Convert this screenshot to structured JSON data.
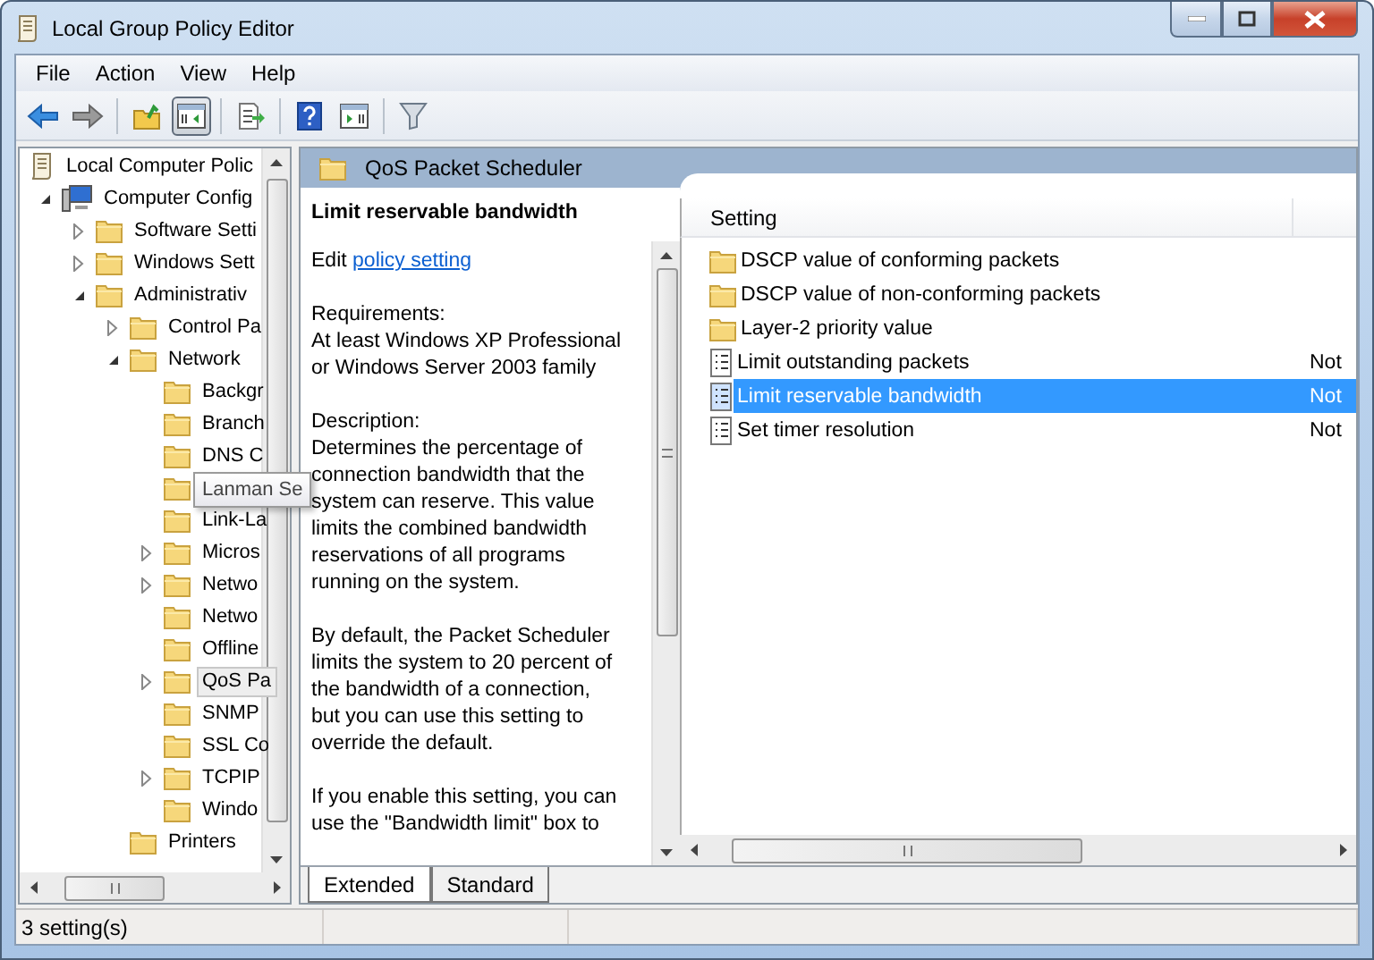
{
  "window": {
    "title": "Local Group Policy Editor"
  },
  "menu": [
    "File",
    "Action",
    "View",
    "Help"
  ],
  "toolbar": [
    {
      "kind": "back",
      "pressed": false
    },
    {
      "kind": "forward",
      "pressed": false
    },
    {
      "kind": "sep"
    },
    {
      "kind": "up",
      "pressed": false
    },
    {
      "kind": "tree",
      "pressed": true
    },
    {
      "kind": "sep"
    },
    {
      "kind": "export",
      "pressed": false
    },
    {
      "kind": "sep"
    },
    {
      "kind": "help",
      "pressed": false
    },
    {
      "kind": "pane",
      "pressed": false
    },
    {
      "kind": "sep"
    },
    {
      "kind": "filter",
      "pressed": false
    }
  ],
  "tree": [
    {
      "label": "Local Computer Polic",
      "kind": "policy",
      "selected": false,
      "children": [
        {
          "label": "Computer Config",
          "kind": "computer",
          "expanded": true,
          "selected": false,
          "children": [
            {
              "label": "Software Setti",
              "kind": "folder",
              "expanded": false,
              "selected": false
            },
            {
              "label": "Windows Sett",
              "kind": "folder",
              "expanded": false,
              "selected": false
            },
            {
              "label": "Administrativ",
              "kind": "folder",
              "expanded": true,
              "selected": false,
              "children": [
                {
                  "label": "Control Pa",
                  "kind": "folder",
                  "expanded": false,
                  "selected": false
                },
                {
                  "label": "Network",
                  "kind": "folder",
                  "expanded": true,
                  "selected": false,
                  "children": [
                    {
                      "label": "Backgr",
                      "kind": "folder",
                      "selected": false
                    },
                    {
                      "label": "Branch",
                      "kind": "folder",
                      "selected": false
                    },
                    {
                      "label": "DNS C",
                      "kind": "folder",
                      "selected": false
                    },
                    {
                      "tooltip": "Lanman Se",
                      "kind": "folder",
                      "selected": false
                    },
                    {
                      "label": "Link-La",
                      "kind": "folder",
                      "selected": false
                    },
                    {
                      "label": "Micros",
                      "kind": "folder",
                      "expanded": false,
                      "selected": false
                    },
                    {
                      "label": "Netwo",
                      "kind": "folder",
                      "expanded": false,
                      "selected": false
                    },
                    {
                      "label": "Netwo",
                      "kind": "folder",
                      "selected": false
                    },
                    {
                      "label": "Offline",
                      "kind": "folder",
                      "selected": false
                    },
                    {
                      "label": "QoS Pa",
                      "kind": "folder",
                      "expanded": false,
                      "selected": true
                    },
                    {
                      "label": "SNMP",
                      "kind": "folder",
                      "selected": false
                    },
                    {
                      "label": "SSL Co",
                      "kind": "folder",
                      "selected": false
                    },
                    {
                      "label": "TCPIP",
                      "kind": "folder",
                      "expanded": false,
                      "selected": false
                    },
                    {
                      "label": "Windo",
                      "kind": "folder",
                      "selected": false
                    }
                  ]
                },
                {
                  "label": "Printers",
                  "kind": "folder",
                  "selected": false
                }
              ]
            }
          ]
        }
      ]
    }
  ],
  "header": {
    "title": "QoS Packet Scheduler"
  },
  "description": {
    "title": "Limit reservable bandwidth",
    "edit_prefix": "Edit",
    "edit_link": "policy setting",
    "paragraphs": [
      [
        "Requirements:",
        "At least Windows XP Professional",
        "or Windows Server 2003 family"
      ],
      [
        "Description:",
        "Determines the percentage of",
        "connection bandwidth that the",
        "system can reserve. This value",
        "limits the combined bandwidth",
        "reservations of all programs",
        "running on the system."
      ],
      [
        "By default, the Packet Scheduler",
        "limits the system to 20 percent of",
        "the bandwidth of a connection,",
        "but you can use this setting to",
        "override the default."
      ],
      [
        "If you enable this setting, you can",
        "use the \"Bandwidth limit\" box to"
      ]
    ]
  },
  "list": {
    "columns": [
      "Setting"
    ],
    "rows": [
      {
        "name": "DSCP value of conforming packets",
        "kind": "folder",
        "selected": false
      },
      {
        "name": "DSCP value of non-conforming packets",
        "kind": "folder",
        "selected": false
      },
      {
        "name": "Layer-2 priority value",
        "kind": "folder",
        "selected": false
      },
      {
        "name": "Limit outstanding packets",
        "kind": "policy",
        "state": "Not",
        "selected": false
      },
      {
        "name": "Limit reservable bandwidth",
        "kind": "policy",
        "state": "Not",
        "selected": true
      },
      {
        "name": "Set timer resolution",
        "kind": "policy",
        "state": "Not",
        "selected": false
      }
    ]
  },
  "tabs": [
    {
      "label": "Extended",
      "selected": true
    },
    {
      "label": "Standard",
      "selected": false
    }
  ],
  "status_bar": [
    "3 setting(s)"
  ]
}
